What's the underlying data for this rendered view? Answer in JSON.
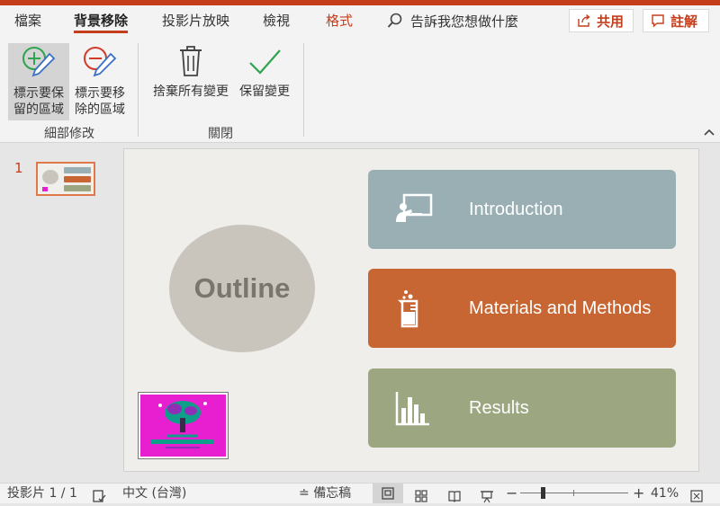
{
  "tabs": [
    {
      "label": "檔案",
      "state": "normal"
    },
    {
      "label": "背景移除",
      "state": "active"
    },
    {
      "label": "投影片放映",
      "state": "normal"
    },
    {
      "label": "檢視",
      "state": "normal"
    },
    {
      "label": "格式",
      "state": "contextual"
    }
  ],
  "tell_me": {
    "icon": "search-icon",
    "text": "告訴我您想做什麼"
  },
  "share_button": {
    "icon": "share-icon",
    "label": "共用"
  },
  "comments_button": {
    "icon": "comment-icon",
    "label": "註解"
  },
  "ribbon": {
    "mark_keep": {
      "icon": "pencil-plus-icon",
      "line1": "標示要保",
      "line2": "留的區域"
    },
    "mark_remove": {
      "icon": "pencil-minus-icon",
      "line1": "標示要移",
      "line2": "除的區域"
    },
    "refine_group": "細部修改",
    "discard": {
      "icon": "trash-icon",
      "label": "捨棄所有變更"
    },
    "keep": {
      "icon": "checkmark-icon",
      "label": "保留變更"
    },
    "close_group": "關閉"
  },
  "thumbnail": {
    "slide_number": "1"
  },
  "slide": {
    "outline": "Outline",
    "cards": [
      {
        "label": "Introduction",
        "icon": "presentation-icon",
        "color": "#9aafb4"
      },
      {
        "label": "Materials and Methods",
        "icon": "beaker-icon",
        "color": "#c86633"
      },
      {
        "label": "Results",
        "icon": "bar-chart-icon",
        "color": "#9ca680"
      }
    ],
    "logo_color": "#e81fd0"
  },
  "status": {
    "slide_info": "投影片 1 / 1",
    "language": "中文 (台灣)",
    "notes": "備忘稿",
    "zoom": "41%",
    "zoom_level": 0.41
  },
  "colors": {
    "accent": "#c43e1c"
  }
}
